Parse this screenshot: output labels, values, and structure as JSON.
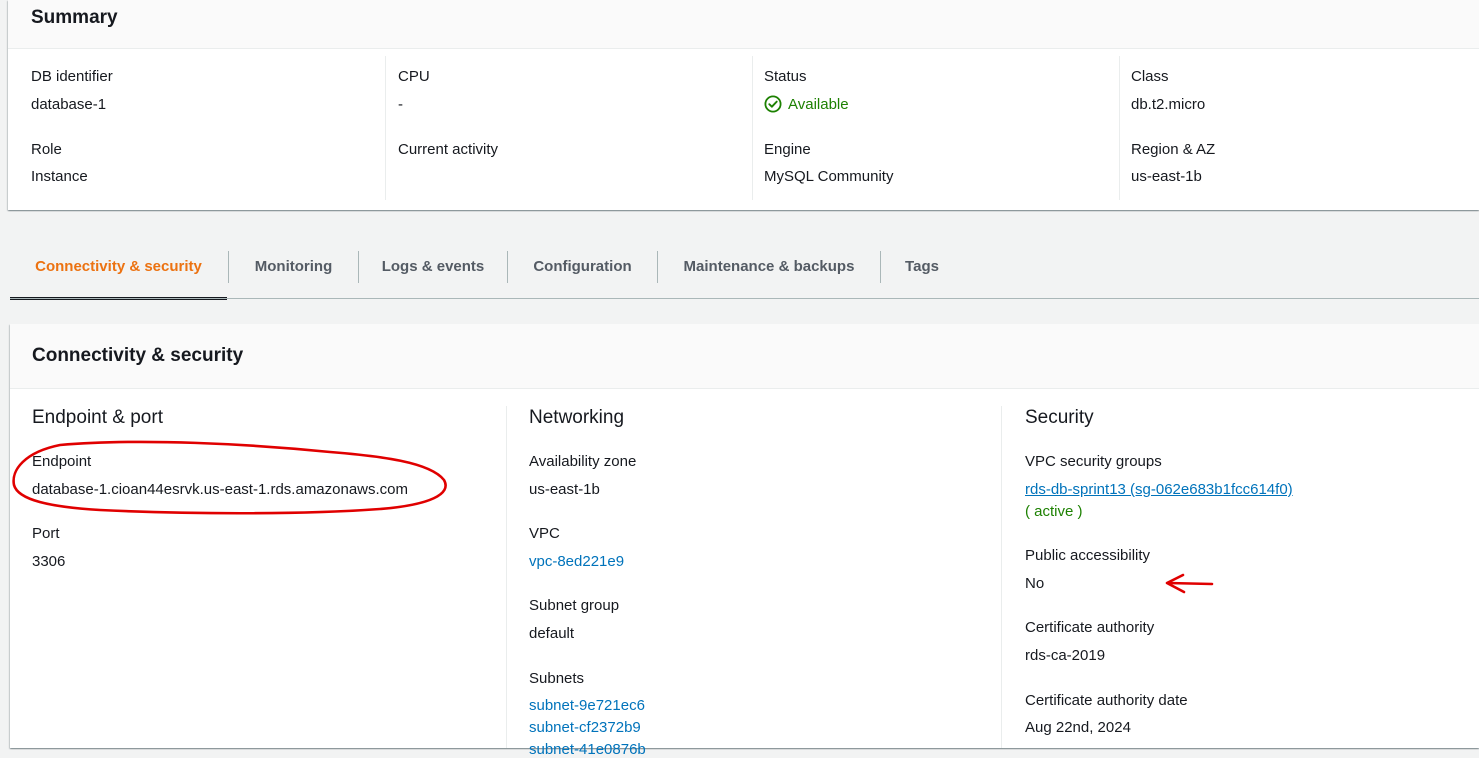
{
  "summary": {
    "title": "Summary",
    "fields": {
      "db_identifier": {
        "label": "DB identifier",
        "value": "database-1"
      },
      "cpu": {
        "label": "CPU",
        "value": "-"
      },
      "status": {
        "label": "Status",
        "value": "Available"
      },
      "class": {
        "label": "Class",
        "value": "db.t2.micro"
      },
      "role": {
        "label": "Role",
        "value": "Instance"
      },
      "current_activity": {
        "label": "Current activity",
        "value": ""
      },
      "engine": {
        "label": "Engine",
        "value": "MySQL Community"
      },
      "region_az": {
        "label": "Region & AZ",
        "value": "us-east-1b"
      }
    }
  },
  "tabs": [
    {
      "label": "Connectivity & security",
      "active": true
    },
    {
      "label": "Monitoring",
      "active": false
    },
    {
      "label": "Logs & events",
      "active": false
    },
    {
      "label": "Configuration",
      "active": false
    },
    {
      "label": "Maintenance & backups",
      "active": false
    },
    {
      "label": "Tags",
      "active": false
    }
  ],
  "connectivity": {
    "title": "Connectivity & security",
    "endpoint_port": {
      "heading": "Endpoint & port",
      "endpoint_label": "Endpoint",
      "endpoint_value": "database-1.cioan44esrvk.us-east-1.rds.amazonaws.com",
      "port_label": "Port",
      "port_value": "3306"
    },
    "networking": {
      "heading": "Networking",
      "az_label": "Availability zone",
      "az_value": "us-east-1b",
      "vpc_label": "VPC",
      "vpc_value": "vpc-8ed221e9",
      "subnet_group_label": "Subnet group",
      "subnet_group_value": "default",
      "subnets_label": "Subnets",
      "subnets": [
        "subnet-9e721ec6",
        "subnet-cf2372b9",
        "subnet-41e0876b"
      ]
    },
    "security": {
      "heading": "Security",
      "vpc_sg_label": "VPC security groups",
      "vpc_sg_value": "rds-db-sprint13 (sg-062e683b1fcc614f0)",
      "vpc_sg_status": "( active )",
      "public_label": "Public accessibility",
      "public_value": "No",
      "ca_label": "Certificate authority",
      "ca_value": "rds-ca-2019",
      "ca_date_label": "Certificate authority date",
      "ca_date_value": "Aug 22nd, 2024"
    }
  },
  "colors": {
    "accent_tab": "#ec7211",
    "link": "#0073bb",
    "status_ok": "#1d8102",
    "annotation": "#e00000"
  },
  "icons": {
    "status": "check-circle-icon",
    "annotation_arrow": "arrow-left-icon"
  }
}
